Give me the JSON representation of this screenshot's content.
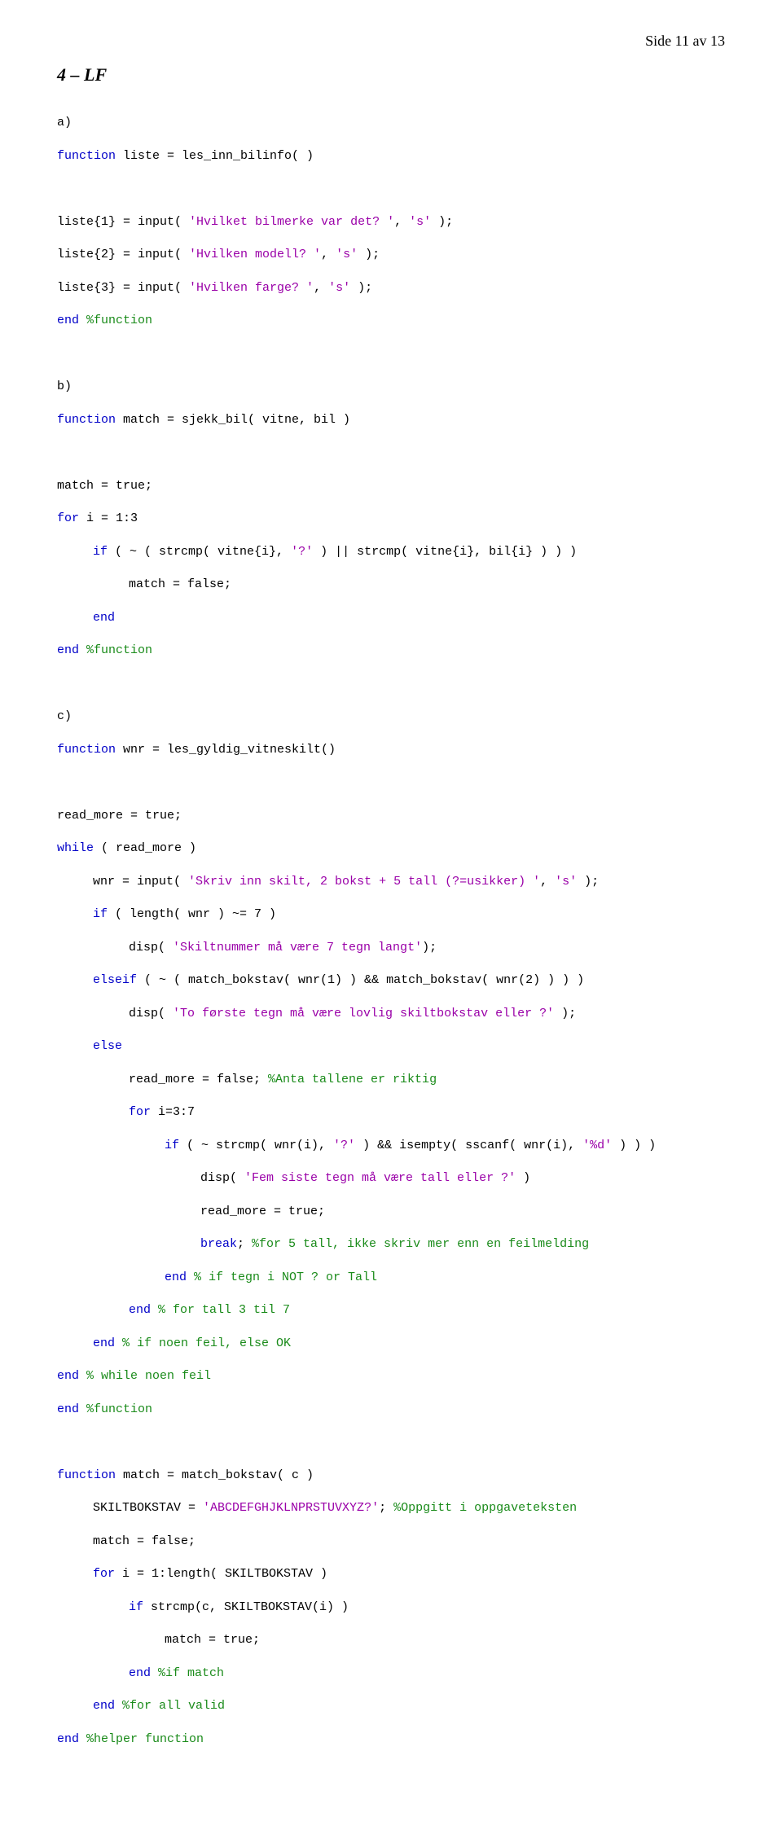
{
  "header": "Side 11 av 13",
  "section": "4 – LF",
  "a": {
    "label": "a)",
    "l1": {
      "p1": "function",
      "p2": " liste = les_inn_bilinfo( )"
    },
    "l2": {
      "p1": "liste{1} = input( ",
      "p2": "'Hvilket bilmerke var det? '",
      "p3": ", ",
      "p4": "'s'",
      "p5": " );"
    },
    "l3": {
      "p1": "liste{2} = input( ",
      "p2": "'Hvilken modell? '",
      "p3": ", ",
      "p4": "'s'",
      "p5": " );"
    },
    "l4": {
      "p1": "liste{3} = input( ",
      "p2": "'Hvilken farge? '",
      "p3": ", ",
      "p4": "'s'",
      "p5": " );"
    },
    "l5": {
      "p1": "end ",
      "p2": "%function"
    }
  },
  "b": {
    "label": "b)",
    "l1": {
      "p1": "function",
      "p2": " match = sjekk_bil( vitne, bil )"
    },
    "l2": "match = true;",
    "l3": {
      "p1": "for",
      "p2": " i = 1:3"
    },
    "l4": {
      "p1": "if",
      "p2": " ( ~ ( strcmp( vitne{i}, ",
      "p3": "'?'",
      "p4": " ) || strcmp( vitne{i}, bil{i} ) ) )"
    },
    "l5": "match = false;",
    "l6": "end",
    "l7": {
      "p1": "end ",
      "p2": "%function"
    }
  },
  "c": {
    "label": "c)",
    "l1": {
      "p1": "function",
      "p2": " wnr = les_gyldig_vitneskilt()"
    },
    "l2": "read_more = true;",
    "l3": {
      "p1": "while",
      "p2": " ( read_more )"
    },
    "l4": {
      "p1": "wnr = input( ",
      "p2": "'Skriv inn skilt, 2 bokst + 5 tall (?=usikker) '",
      "p3": ", ",
      "p4": "'s'",
      "p5": " );"
    },
    "l5": {
      "p1": "if",
      "p2": " ( length( wnr ) ~= 7 )"
    },
    "l6": {
      "p1": "disp( ",
      "p2": "'Skiltnummer må være 7 tegn langt'",
      "p3": ");"
    },
    "l7": {
      "p1": "elseif",
      "p2": " ( ~ ( match_bokstav( wnr(1) ) && match_bokstav( wnr(2) ) ) )"
    },
    "l8": {
      "p1": "disp( ",
      "p2": "'To første tegn må være lovlig skiltbokstav eller ?'",
      "p3": " );"
    },
    "l9": "else",
    "l10": {
      "p1": "read_more = false; ",
      "p2": "%Anta tallene er riktig"
    },
    "l11": {
      "p1": "for",
      "p2": " i=3:7"
    },
    "l12": {
      "p1": "if",
      "p2": " ( ~ strcmp( wnr(i), ",
      "p3": "'?'",
      "p4": " ) && isempty( sscanf( wnr(i), ",
      "p5": "'%d'",
      "p6": " ) ) )"
    },
    "l13": {
      "p1": "disp( ",
      "p2": "'Fem siste tegn må være tall eller ?'",
      "p3": " )"
    },
    "l14": "read_more = true;",
    "l15": {
      "p1": "break",
      "p2": "; ",
      "p3": "%for 5 tall, ikke skriv mer enn en feilmelding"
    },
    "l16": {
      "p1": "end ",
      "p2": "% if tegn i NOT ? or Tall"
    },
    "l17": {
      "p1": "end ",
      "p2": "% for tall 3 til 7"
    },
    "l18": {
      "p1": "end ",
      "p2": "% if noen feil, else OK"
    },
    "l19": {
      "p1": "end ",
      "p2": "% while noen feil"
    },
    "l20": {
      "p1": "end ",
      "p2": "%function"
    }
  },
  "d": {
    "l1": {
      "p1": "function",
      "p2": " match = match_bokstav( c )"
    },
    "l2": {
      "p1": "SKILTBOKSTAV = ",
      "p2": "'ABCDEFGHJKLNPRSTUVXYZ?'",
      "p3": "; ",
      "p4": "%Oppgitt i oppgaveteksten"
    },
    "l3": "match = false;",
    "l4": {
      "p1": "for",
      "p2": " i = 1:length( SKILTBOKSTAV )"
    },
    "l5": {
      "p1": "if",
      "p2": " strcmp(c, SKILTBOKSTAV(i) )"
    },
    "l6": "match = true;",
    "l7": {
      "p1": "end ",
      "p2": "%if match"
    },
    "l8": {
      "p1": "end ",
      "p2": "%for all valid"
    },
    "l9": {
      "p1": "end ",
      "p2": "%helper function"
    }
  }
}
